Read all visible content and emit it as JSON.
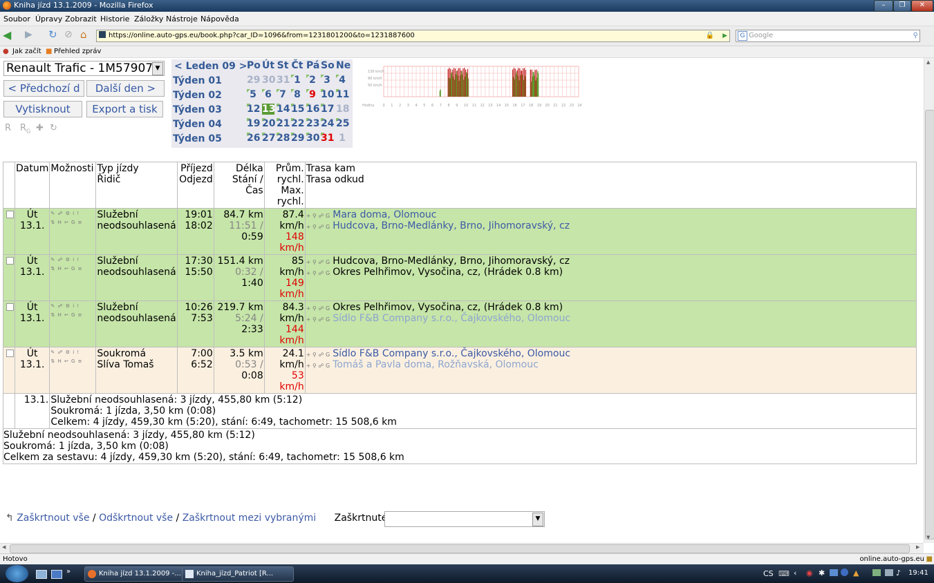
{
  "window": {
    "title": "Kniha jízd 13.1.2009 - Mozilla Firefox"
  },
  "menu": [
    "Soubor",
    "Úpravy",
    "Zobrazit",
    "Historie",
    "Záložky",
    "Nástroje",
    "Nápověda"
  ],
  "nav": {
    "url": "https://online.auto-gps.eu/book.php?car_ID=1096&from=1231801200&to=1231887600",
    "search_placeholder": "Google"
  },
  "bookmarks": [
    "Jak začít",
    "Přehled zpráv"
  ],
  "car": {
    "selected": "Renault Trafic - 1M57907"
  },
  "buttons": {
    "prev": "< Předchozí d",
    "next": "Další den >",
    "print": "Vytisknout",
    "export": "Export a tisk"
  },
  "calendar": {
    "month": "< Leden 09 >",
    "days": [
      "Po",
      "Út",
      "St",
      "Čt",
      "Pá",
      "So",
      "Ne"
    ],
    "weeks": [
      {
        "label": "Týden 01",
        "dates": [
          "29",
          "30",
          "31",
          "1",
          "2",
          "3",
          "4"
        ]
      },
      {
        "label": "Týden 02",
        "dates": [
          "5",
          "6",
          "7",
          "8",
          "9",
          "10",
          "11"
        ]
      },
      {
        "label": "Týden 03",
        "dates": [
          "12",
          "13",
          "14",
          "15",
          "16",
          "17",
          "18"
        ]
      },
      {
        "label": "Týden 04",
        "dates": [
          "19",
          "20",
          "21",
          "22",
          "23",
          "24",
          "25"
        ]
      },
      {
        "label": "Týden 05",
        "dates": [
          "26",
          "27",
          "28",
          "29",
          "30",
          "31",
          "1"
        ]
      }
    ]
  },
  "speed_chart": {
    "y_labels": [
      "130 km/h",
      "90 km/h",
      "50 km/h"
    ],
    "x_label": "Hodiny",
    "hours": [
      "0",
      "1",
      "2",
      "3",
      "4",
      "5",
      "6",
      "7",
      "8",
      "9",
      "10",
      "11",
      "12",
      "13",
      "14",
      "15",
      "16",
      "17",
      "18",
      "19",
      "20",
      "21",
      "22",
      "23",
      "24"
    ]
  },
  "table": {
    "headers": {
      "datum": "Datum",
      "moznosti": "Možnosti",
      "typ": [
        "Typ jízdy",
        "Řidič"
      ],
      "prijezd": [
        "Příjezd",
        "Odjezd"
      ],
      "delka": [
        "Délka",
        "Stání /",
        "Čas"
      ],
      "prum": [
        "Prům.",
        "rychl.",
        "Max.",
        "rychl."
      ],
      "trasa": [
        "Trasa kam",
        "Trasa odkud"
      ]
    },
    "rows": [
      {
        "day": "Út",
        "date": "13.1.",
        "type": "Služební",
        "driver": "neodsouhlasená",
        "arrive": "19:01",
        "depart": "18:02",
        "length": "84.7 km",
        "stop": "11:51 /",
        "time": "0:59",
        "avg": "87.4 km/h",
        "max": "148 km/h",
        "to": "Mara doma, Olomouc",
        "from": "Hudcova, Brno-Medlánky, Brno, Jihomoravský, cz"
      },
      {
        "day": "Út",
        "date": "13.1.",
        "type": "Služební",
        "driver": "neodsouhlasená",
        "arrive": "17:30",
        "depart": "15:50",
        "length": "151.4 km",
        "stop": "0:32 /",
        "time": "1:40",
        "avg": "85 km/h",
        "max": "149 km/h",
        "to": "Hudcova, Brno-Medlánky, Brno, Jihomoravský, cz",
        "from": "Okres Pelhřimov, Vysočina, cz, (Hrádek 0.8 km)"
      },
      {
        "day": "Út",
        "date": "13.1.",
        "type": "Služební",
        "driver": "neodsouhlasená",
        "arrive": "10:26",
        "depart": "7:53",
        "length": "219.7 km",
        "stop": "5:24 /",
        "time": "2:33",
        "avg": "84.3 km/h",
        "max": "144 km/h",
        "to": "Okres Pelhřimov, Vysočina, cz, (Hrádek 0.8 km)",
        "from": "Sídlo F&B Company s.r.o., Čajkovského, Olomouc"
      },
      {
        "day": "Út",
        "date": "13.1.",
        "type": "Soukromá",
        "driver": "Slíva Tomaš",
        "arrive": "7:00",
        "depart": "6:52",
        "length": "3.5 km",
        "stop": "0:53 /",
        "time": "0:08",
        "avg": "24.1 km/h",
        "max": "53 km/h",
        "to": "Sídlo F&B Company s.r.o., Čajkovského, Olomouc",
        "from": "Tomáš a Pavla doma, Rožňavská, Olomouc"
      }
    ],
    "day_summary": {
      "date": "13.1.",
      "lines": [
        "Služební neodsouhlasená: 3 jízdy, 455,80 km (5:12)",
        "Soukromá: 1 jízda, 3,50 km (0:08)",
        "Celkem: 4 jízdy, 459,30 km (5:20), stání: 6:49, tachometr: 15 508,6 km"
      ]
    },
    "total_summary": [
      "Služební neodsouhlasená: 3 jízdy, 455,80 km (5:12)",
      "Soukromá: 1 jízda, 3,50 km (0:08)",
      "Celkem za sestavu: 4 jízdy, 459,30 km (5:20), stání: 6:49, tachometr: 15 508,6 km"
    ]
  },
  "bottom": {
    "check_all": "Zaškrtnout vše",
    "uncheck_all": "Odškrtnout vše",
    "check_between": "Zaškrtnout mezi vybranými",
    "checked_label": "Zaškrtnuté:",
    "sep": " / "
  },
  "status": {
    "left": "Hotovo",
    "right": "online.auto-gps.eu"
  },
  "taskbar": {
    "items": [
      "Kniha jízd 13.1.2009 -...",
      "Kniha_jízd_Patriot [R..."
    ],
    "lang": "CS",
    "clock": "19:41"
  }
}
